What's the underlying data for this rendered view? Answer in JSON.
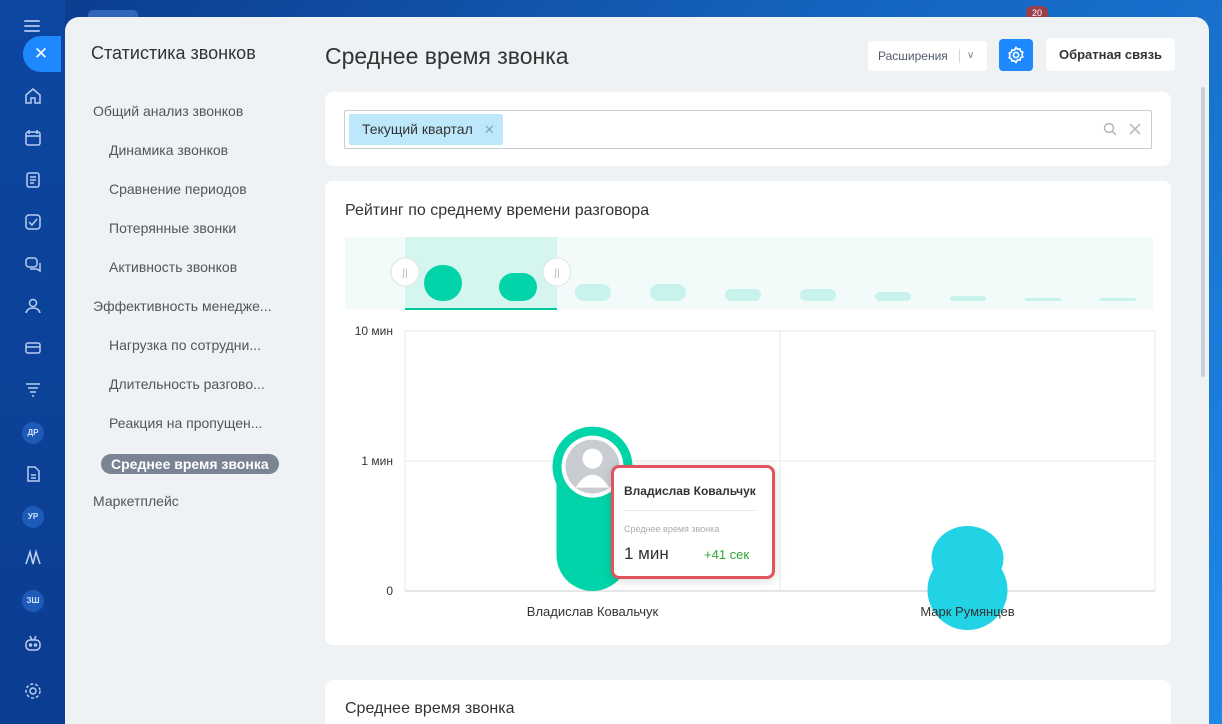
{
  "rail": {
    "badge": "20",
    "avatars": [
      "ДР",
      "УР",
      "ЗШ"
    ]
  },
  "sidebar": {
    "title": "Статистика звонков",
    "items": [
      {
        "label": "Общий анализ звонков",
        "level": "top"
      },
      {
        "label": "Динамика звонков",
        "level": "sub"
      },
      {
        "label": "Сравнение периодов",
        "level": "sub"
      },
      {
        "label": "Потерянные звонки",
        "level": "sub"
      },
      {
        "label": "Активность звонков",
        "level": "sub"
      },
      {
        "label": "Эффективность менедже...",
        "level": "top"
      },
      {
        "label": "Нагрузка по сотрудни...",
        "level": "sub"
      },
      {
        "label": "Длительность разгово...",
        "level": "sub"
      },
      {
        "label": "Реакция на пропущен...",
        "level": "sub"
      },
      {
        "label": "Среднее время звонка",
        "level": "sub",
        "active": true
      },
      {
        "label": "Маркетплейс",
        "level": "top"
      }
    ]
  },
  "header": {
    "title": "Среднее время звонка",
    "extensions_label": "Расширения",
    "feedback_label": "Обратная связь"
  },
  "filter": {
    "chip_label": "Текущий квартал"
  },
  "chart_card": {
    "title": "Рейтинг по среднему времени разговора"
  },
  "chart_data": {
    "type": "bar",
    "title": "Рейтинг по среднему времени разговора",
    "categories": [
      "Владислав Ковальчук",
      "Марк Румянцев"
    ],
    "values_seconds": [
      101,
      30
    ],
    "y_scale": "log",
    "y_ticks": [
      "0",
      "1 мин",
      "10 мин"
    ],
    "colors": [
      "#00d4a8",
      "#22d3e6"
    ],
    "grid": true
  },
  "tooltip": {
    "name": "Владислав Ковальчук",
    "label": "Среднее время звонка",
    "value": "1 мин",
    "delta": "+41 сек"
  },
  "bottom_card": {
    "title": "Среднее время звонка"
  }
}
